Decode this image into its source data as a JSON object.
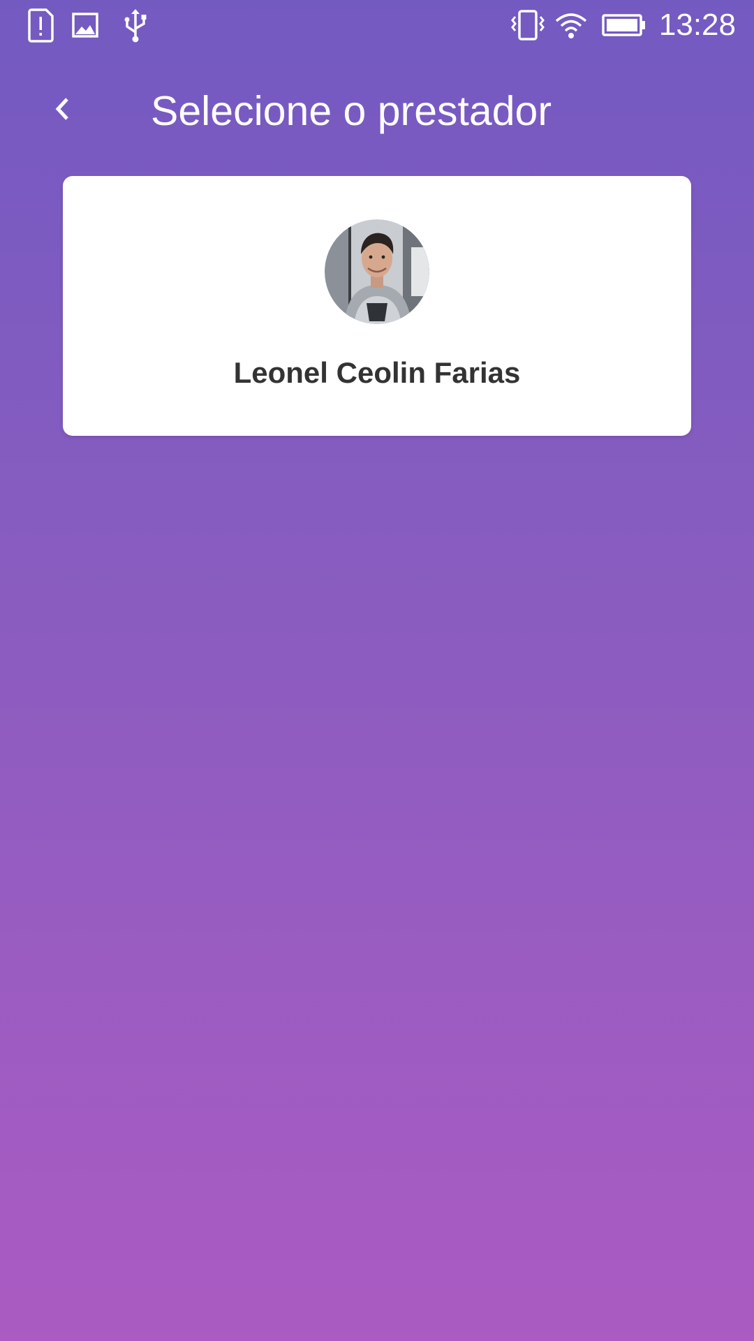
{
  "status_bar": {
    "time": "13:28",
    "left_icons": [
      "sim-alert-icon",
      "image-icon",
      "usb-icon"
    ],
    "right_icons": [
      "vibrate-icon",
      "wifi-icon",
      "battery-icon"
    ]
  },
  "header": {
    "back_icon": "chevron-left-icon",
    "title": "Selecione o prestador"
  },
  "providers": [
    {
      "name": "Leonel Ceolin Farias",
      "avatar": "profile-photo"
    }
  ],
  "colors": {
    "gradient_top": "#735ac1",
    "gradient_bottom": "#ab5bc2",
    "card_background": "#ffffff",
    "name_text": "#333333",
    "title_text": "#ffffff"
  }
}
